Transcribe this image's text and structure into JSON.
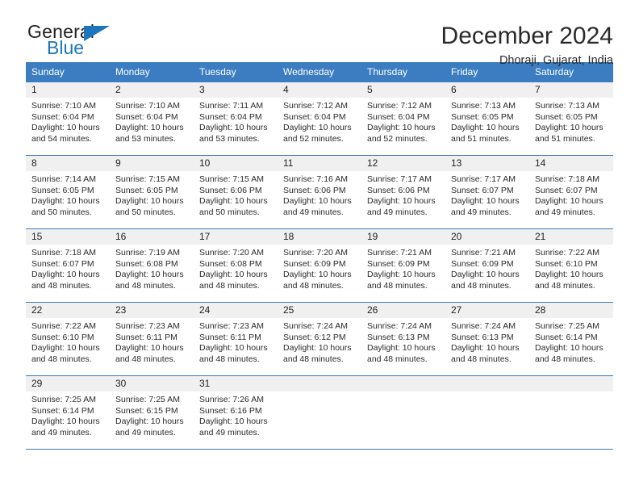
{
  "brand": {
    "name_top": "General",
    "name_bottom": "Blue",
    "color_primary": "#1b76bc"
  },
  "header": {
    "title": "December 2024",
    "location": "Dhoraji, Gujarat, India"
  },
  "calendar": {
    "header_color": "#3b7dc0",
    "weekdays": [
      "Sunday",
      "Monday",
      "Tuesday",
      "Wednesday",
      "Thursday",
      "Friday",
      "Saturday"
    ],
    "weeks": [
      [
        {
          "day": "1",
          "sunrise": "Sunrise: 7:10 AM",
          "sunset": "Sunset: 6:04 PM",
          "daylight": "Daylight: 10 hours and 54 minutes."
        },
        {
          "day": "2",
          "sunrise": "Sunrise: 7:10 AM",
          "sunset": "Sunset: 6:04 PM",
          "daylight": "Daylight: 10 hours and 53 minutes."
        },
        {
          "day": "3",
          "sunrise": "Sunrise: 7:11 AM",
          "sunset": "Sunset: 6:04 PM",
          "daylight": "Daylight: 10 hours and 53 minutes."
        },
        {
          "day": "4",
          "sunrise": "Sunrise: 7:12 AM",
          "sunset": "Sunset: 6:04 PM",
          "daylight": "Daylight: 10 hours and 52 minutes."
        },
        {
          "day": "5",
          "sunrise": "Sunrise: 7:12 AM",
          "sunset": "Sunset: 6:04 PM",
          "daylight": "Daylight: 10 hours and 52 minutes."
        },
        {
          "day": "6",
          "sunrise": "Sunrise: 7:13 AM",
          "sunset": "Sunset: 6:05 PM",
          "daylight": "Daylight: 10 hours and 51 minutes."
        },
        {
          "day": "7",
          "sunrise": "Sunrise: 7:13 AM",
          "sunset": "Sunset: 6:05 PM",
          "daylight": "Daylight: 10 hours and 51 minutes."
        }
      ],
      [
        {
          "day": "8",
          "sunrise": "Sunrise: 7:14 AM",
          "sunset": "Sunset: 6:05 PM",
          "daylight": "Daylight: 10 hours and 50 minutes."
        },
        {
          "day": "9",
          "sunrise": "Sunrise: 7:15 AM",
          "sunset": "Sunset: 6:05 PM",
          "daylight": "Daylight: 10 hours and 50 minutes."
        },
        {
          "day": "10",
          "sunrise": "Sunrise: 7:15 AM",
          "sunset": "Sunset: 6:06 PM",
          "daylight": "Daylight: 10 hours and 50 minutes."
        },
        {
          "day": "11",
          "sunrise": "Sunrise: 7:16 AM",
          "sunset": "Sunset: 6:06 PM",
          "daylight": "Daylight: 10 hours and 49 minutes."
        },
        {
          "day": "12",
          "sunrise": "Sunrise: 7:17 AM",
          "sunset": "Sunset: 6:06 PM",
          "daylight": "Daylight: 10 hours and 49 minutes."
        },
        {
          "day": "13",
          "sunrise": "Sunrise: 7:17 AM",
          "sunset": "Sunset: 6:07 PM",
          "daylight": "Daylight: 10 hours and 49 minutes."
        },
        {
          "day": "14",
          "sunrise": "Sunrise: 7:18 AM",
          "sunset": "Sunset: 6:07 PM",
          "daylight": "Daylight: 10 hours and 49 minutes."
        }
      ],
      [
        {
          "day": "15",
          "sunrise": "Sunrise: 7:18 AM",
          "sunset": "Sunset: 6:07 PM",
          "daylight": "Daylight: 10 hours and 48 minutes."
        },
        {
          "day": "16",
          "sunrise": "Sunrise: 7:19 AM",
          "sunset": "Sunset: 6:08 PM",
          "daylight": "Daylight: 10 hours and 48 minutes."
        },
        {
          "day": "17",
          "sunrise": "Sunrise: 7:20 AM",
          "sunset": "Sunset: 6:08 PM",
          "daylight": "Daylight: 10 hours and 48 minutes."
        },
        {
          "day": "18",
          "sunrise": "Sunrise: 7:20 AM",
          "sunset": "Sunset: 6:09 PM",
          "daylight": "Daylight: 10 hours and 48 minutes."
        },
        {
          "day": "19",
          "sunrise": "Sunrise: 7:21 AM",
          "sunset": "Sunset: 6:09 PM",
          "daylight": "Daylight: 10 hours and 48 minutes."
        },
        {
          "day": "20",
          "sunrise": "Sunrise: 7:21 AM",
          "sunset": "Sunset: 6:09 PM",
          "daylight": "Daylight: 10 hours and 48 minutes."
        },
        {
          "day": "21",
          "sunrise": "Sunrise: 7:22 AM",
          "sunset": "Sunset: 6:10 PM",
          "daylight": "Daylight: 10 hours and 48 minutes."
        }
      ],
      [
        {
          "day": "22",
          "sunrise": "Sunrise: 7:22 AM",
          "sunset": "Sunset: 6:10 PM",
          "daylight": "Daylight: 10 hours and 48 minutes."
        },
        {
          "day": "23",
          "sunrise": "Sunrise: 7:23 AM",
          "sunset": "Sunset: 6:11 PM",
          "daylight": "Daylight: 10 hours and 48 minutes."
        },
        {
          "day": "24",
          "sunrise": "Sunrise: 7:23 AM",
          "sunset": "Sunset: 6:11 PM",
          "daylight": "Daylight: 10 hours and 48 minutes."
        },
        {
          "day": "25",
          "sunrise": "Sunrise: 7:24 AM",
          "sunset": "Sunset: 6:12 PM",
          "daylight": "Daylight: 10 hours and 48 minutes."
        },
        {
          "day": "26",
          "sunrise": "Sunrise: 7:24 AM",
          "sunset": "Sunset: 6:13 PM",
          "daylight": "Daylight: 10 hours and 48 minutes."
        },
        {
          "day": "27",
          "sunrise": "Sunrise: 7:24 AM",
          "sunset": "Sunset: 6:13 PM",
          "daylight": "Daylight: 10 hours and 48 minutes."
        },
        {
          "day": "28",
          "sunrise": "Sunrise: 7:25 AM",
          "sunset": "Sunset: 6:14 PM",
          "daylight": "Daylight: 10 hours and 48 minutes."
        }
      ],
      [
        {
          "day": "29",
          "sunrise": "Sunrise: 7:25 AM",
          "sunset": "Sunset: 6:14 PM",
          "daylight": "Daylight: 10 hours and 49 minutes."
        },
        {
          "day": "30",
          "sunrise": "Sunrise: 7:25 AM",
          "sunset": "Sunset: 6:15 PM",
          "daylight": "Daylight: 10 hours and 49 minutes."
        },
        {
          "day": "31",
          "sunrise": "Sunrise: 7:26 AM",
          "sunset": "Sunset: 6:16 PM",
          "daylight": "Daylight: 10 hours and 49 minutes."
        },
        {
          "day": "",
          "sunrise": "",
          "sunset": "",
          "daylight": ""
        },
        {
          "day": "",
          "sunrise": "",
          "sunset": "",
          "daylight": ""
        },
        {
          "day": "",
          "sunrise": "",
          "sunset": "",
          "daylight": ""
        },
        {
          "day": "",
          "sunrise": "",
          "sunset": "",
          "daylight": ""
        }
      ]
    ]
  }
}
